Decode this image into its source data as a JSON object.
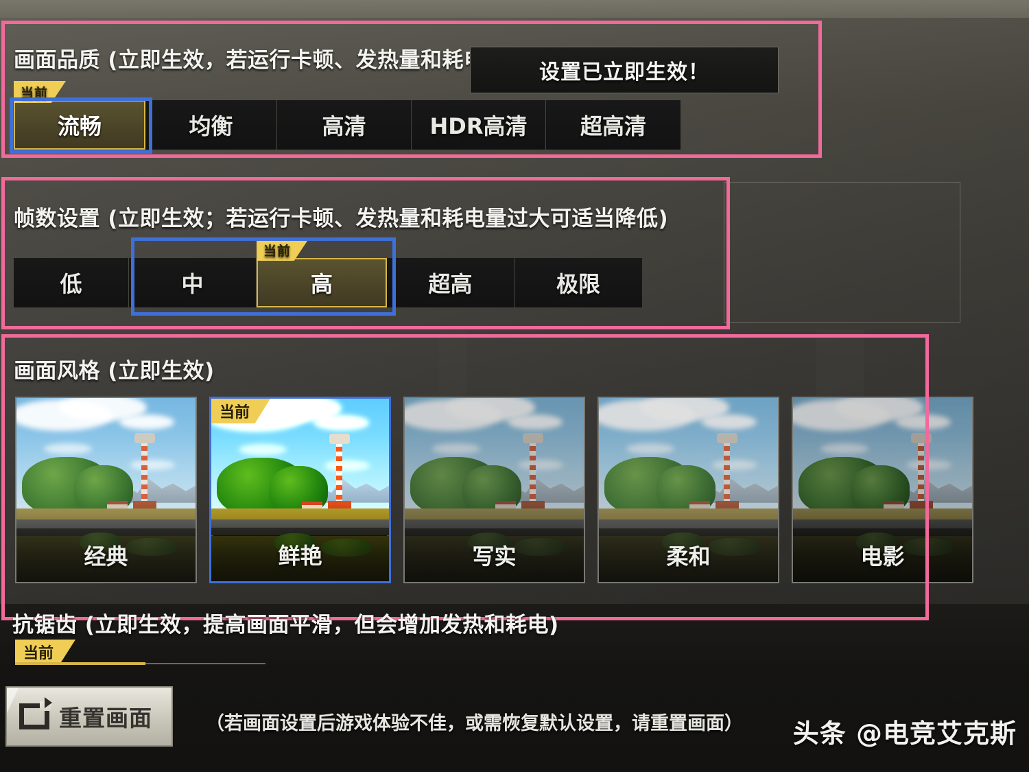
{
  "toast": {
    "text": "设置已立即生效！"
  },
  "quality": {
    "heading": "画面品质 (立即生效，若运行卡顿、发热量和耗电量过大可适当降低)",
    "current_badge": "当前",
    "selected": "流畅",
    "options": [
      {
        "label": "流畅"
      },
      {
        "label": "均衡"
      },
      {
        "label": "高清"
      },
      {
        "label": "HDR高清"
      },
      {
        "label": "超高清"
      }
    ]
  },
  "framerate": {
    "heading": "帧数设置 (立即生效；若运行卡顿、发热量和耗电量过大可适当降低)",
    "current_badge": "当前",
    "selected": "高",
    "options": [
      {
        "label": "低"
      },
      {
        "label": "中"
      },
      {
        "label": "高"
      },
      {
        "label": "超高"
      },
      {
        "label": "极限"
      }
    ]
  },
  "style": {
    "heading": "画面风格 (立即生效)",
    "current_badge": "当前",
    "selected": "鲜艳",
    "options": [
      {
        "label": "经典"
      },
      {
        "label": "鲜艳"
      },
      {
        "label": "写实"
      },
      {
        "label": "柔和"
      },
      {
        "label": "电影"
      }
    ]
  },
  "antialias": {
    "heading": "抗锯齿 (立即生效，提高画面平滑，但会增加发热和耗电)",
    "current_badge": "当前"
  },
  "footer": {
    "reset_label": "重置画面",
    "note": "（若画面设置后游戏体验不佳，或需恢复默认设置，请重置画面）"
  },
  "watermark": {
    "text": "头条 @电竞艾克斯"
  },
  "colors": {
    "annotation_pink": "#f2699b",
    "annotation_blue": "#3f6fd8",
    "badge_yellow": "#f0ce55",
    "selected_fill": "#4a4327",
    "selected_border": "#d6b64a"
  }
}
